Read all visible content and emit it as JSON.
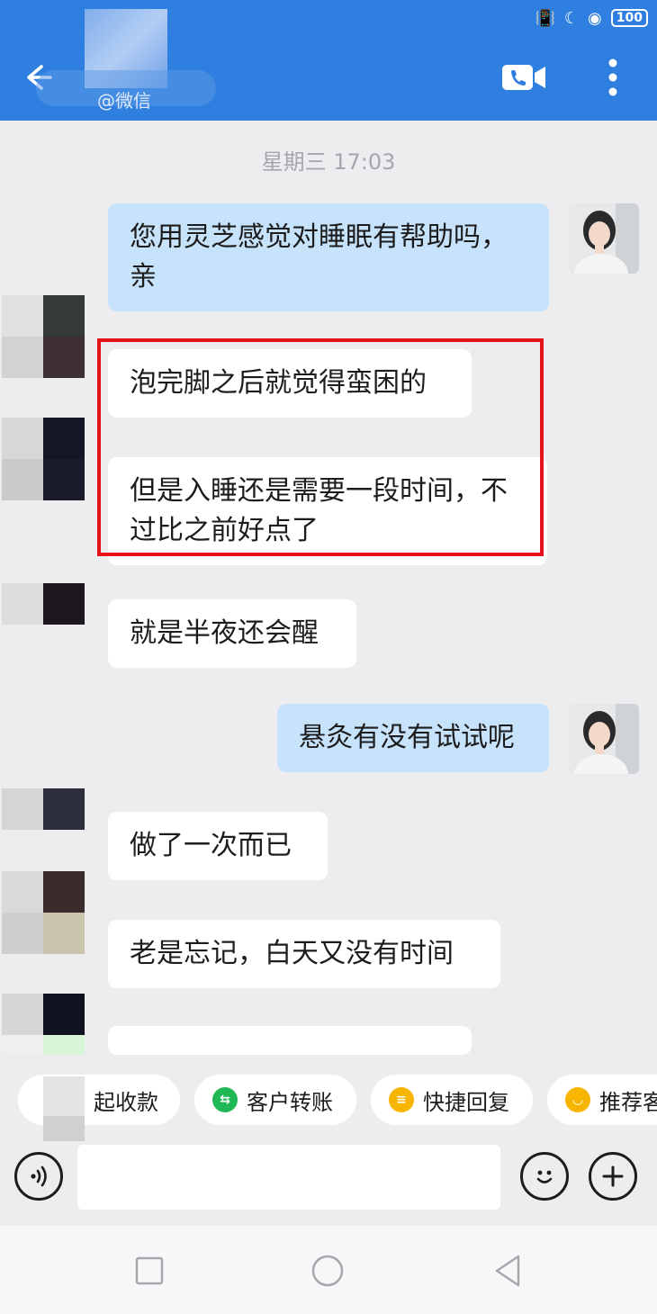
{
  "header": {
    "subtitle": "@微信",
    "battery": "100"
  },
  "chat": {
    "timestamp": "星期三  17:03",
    "messages": [
      {
        "direction": "out",
        "text": "您用灵芝感觉对睡眠有帮助吗，亲"
      },
      {
        "direction": "in",
        "text": "泡完脚之后就觉得蛮困的"
      },
      {
        "direction": "in",
        "text": "但是入睡还是需要一段时间，不过比之前好点了"
      },
      {
        "direction": "in",
        "text": "就是半夜还会醒"
      },
      {
        "direction": "out",
        "text": "悬灸有没有试试呢"
      },
      {
        "direction": "in",
        "text": "做了一次而已"
      },
      {
        "direction": "in",
        "text": "老是忘记，白天又没有时间"
      }
    ]
  },
  "quick_actions": [
    {
      "label": "起收款",
      "icon": "payment-icon",
      "color": "#ffffff"
    },
    {
      "label": "客户转账",
      "icon": "transfer-icon",
      "color": "#1fb855"
    },
    {
      "label": "快捷回复",
      "icon": "quick-reply-icon",
      "color": "#f7b500"
    },
    {
      "label": "推荐客",
      "icon": "recommend-icon",
      "color": "#f7b500"
    }
  ],
  "input": {
    "placeholder": ""
  },
  "colors": {
    "header": "#2f7fe0",
    "outgoing_bubble": "#c7e3fb",
    "incoming_bubble": "#ffffff",
    "highlight": "#e8101b"
  }
}
